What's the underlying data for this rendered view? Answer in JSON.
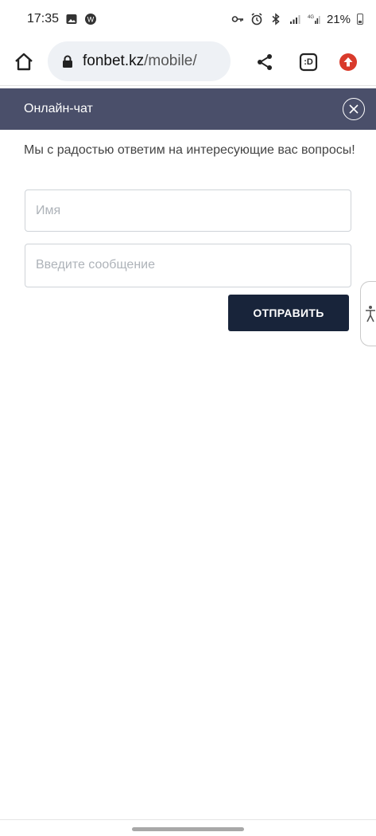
{
  "status_bar": {
    "time": "17:35",
    "battery": "21%",
    "icons_left": [
      "image-icon",
      "app-badge-icon"
    ],
    "icons_right": [
      "key-icon",
      "alarm-icon",
      "bluetooth-icon",
      "signal-icon",
      "4g-signal-icon",
      "battery-icon"
    ]
  },
  "browser": {
    "url_domain": "fonbet.kz",
    "url_path": "/mobile/",
    "tabs_label": ":D",
    "icons": [
      "home-icon",
      "lock-icon",
      "share-icon",
      "tabs-icon",
      "update-icon"
    ],
    "update_color": "#d93a2b"
  },
  "chat": {
    "title": "Онлайн-чат",
    "header_color": "#4a4f6a",
    "intro": "Мы с радостью ответим на интересующие вас вопросы!",
    "name_placeholder": "Имя",
    "message_placeholder": "Введите сообщение",
    "send_label": "ОТПРАВИТЬ",
    "send_color": "#18243a"
  }
}
